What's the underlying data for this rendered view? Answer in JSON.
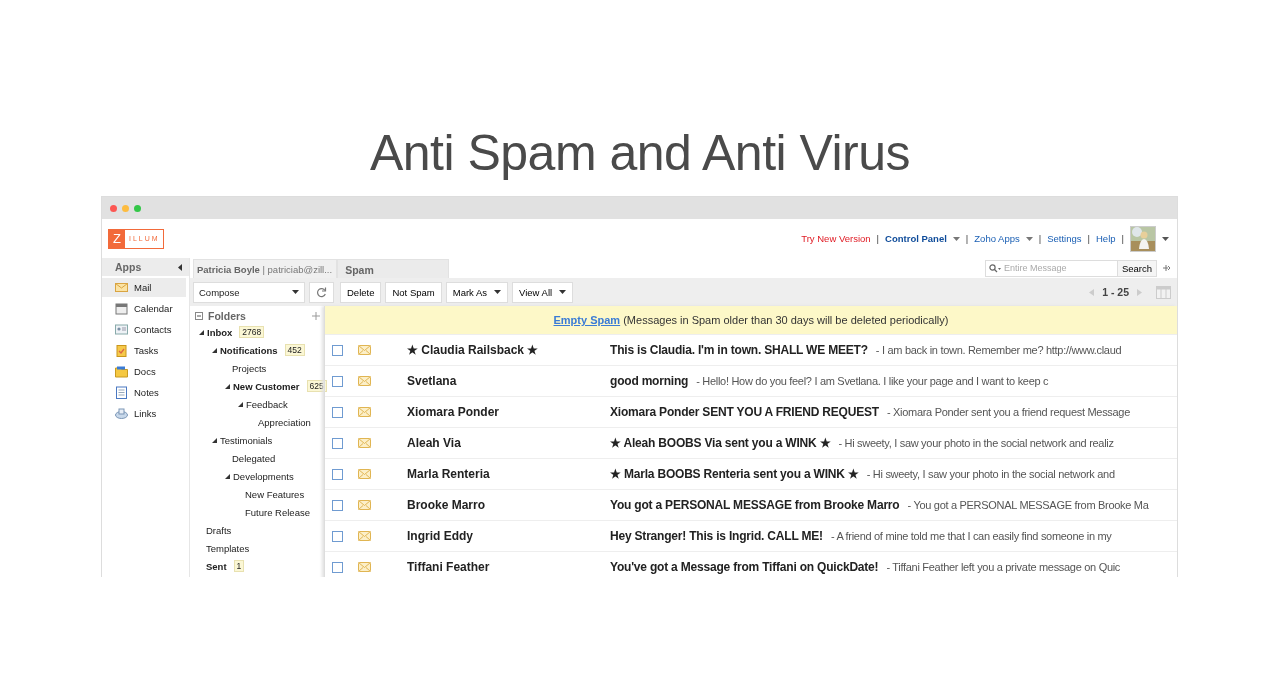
{
  "page_title": "Anti Spam and Anti Virus",
  "app": {
    "logo_letter": "Z",
    "logo_text": "ILLUM",
    "top_links": [
      {
        "label": "Try New Version",
        "kind": "alert",
        "separator": "|"
      },
      {
        "label": "Control Panel",
        "kind": "strong",
        "dropdown": true,
        "separator": "|"
      },
      {
        "label": "Zoho Apps",
        "kind": "link",
        "dropdown": true,
        "separator": "|"
      },
      {
        "label": "Settings",
        "kind": "link",
        "separator": "|"
      },
      {
        "label": "Help",
        "kind": "link",
        "separator": "|"
      }
    ],
    "apps_header": "Apps",
    "apps": [
      {
        "label": "Mail",
        "kind": "mail",
        "selected": true
      },
      {
        "label": "Calendar",
        "kind": "calendar",
        "selected": false
      },
      {
        "label": "Contacts",
        "kind": "contacts",
        "selected": false
      },
      {
        "label": "Tasks",
        "kind": "tasks",
        "selected": false
      },
      {
        "label": "Docs",
        "kind": "docs",
        "selected": false
      },
      {
        "label": "Notes",
        "kind": "notes",
        "selected": false
      },
      {
        "label": "Links",
        "kind": "links",
        "selected": false
      }
    ],
    "account_tab": {
      "name": "Patricia Boyle",
      "email": "| patriciab@zill..."
    },
    "tabs": [
      {
        "label": "Spam",
        "selected": true
      }
    ],
    "search": {
      "placeholder": "Entire Message",
      "button": "Search"
    },
    "compose": "Compose",
    "toolbar": [
      {
        "label": "Delete"
      },
      {
        "label": "Not Spam"
      },
      {
        "label": "Mark As",
        "dropdown": true
      },
      {
        "label": "View All",
        "dropdown": true
      }
    ],
    "pager": "1 - 25",
    "folders": {
      "title": "Folders",
      "items": [
        {
          "name": "Inbox",
          "count": "2768",
          "expanded": true,
          "children": [
            {
              "name": "Notifications",
              "count": "452",
              "expanded": true,
              "children": [
                {
                  "name": "Projects"
                },
                {
                  "name": "New Customer",
                  "count": "625",
                  "expanded": true,
                  "children": [
                    {
                      "name": "Feedback",
                      "expanded": true,
                      "children": [
                        {
                          "name": "Appreciation"
                        }
                      ]
                    }
                  ]
                }
              ]
            },
            {
              "name": "Testimonials",
              "expanded": true,
              "children": [
                {
                  "name": "Delegated"
                },
                {
                  "name": "Developments",
                  "expanded": true,
                  "children": [
                    {
                      "name": "New Features"
                    },
                    {
                      "name": "Future Release"
                    }
                  ]
                }
              ]
            }
          ]
        },
        {
          "name": "Drafts"
        },
        {
          "name": "Templates"
        },
        {
          "name": "Sent",
          "count": "1"
        }
      ]
    },
    "banner": {
      "link": "Empty Spam",
      "text": "(Messages in Spam older than 30 days will be deleted periodically)"
    },
    "messages": [
      {
        "sender": "★ Claudia Railsback ★",
        "subject": "This is Claudia. I'm in town. SHALL WE MEET?",
        "preview": "- I am back in town. Remember me? http://www.claud",
        "checked": false
      },
      {
        "sender": "Svetlana",
        "subject": "good morning",
        "preview": "- Hello! How do you feel? I am Svetlana. I like your page and I want to keep c",
        "checked": false
      },
      {
        "sender": "Xiomara Ponder",
        "subject": "Xiomara Ponder SENT YOU A FRIEND REQUEST",
        "preview": "- Xiomara Ponder sent you a friend request Message",
        "checked": false
      },
      {
        "sender": "Aleah Via",
        "subject": "★ Aleah BOOBS Via sent you a WINK ★",
        "preview": "- Hi sweety, I saw your photo in the social network and realiz",
        "checked": false
      },
      {
        "sender": "Marla Renteria",
        "subject": "★ Marla BOOBS Renteria sent you a WINK ★",
        "preview": "- Hi sweety, I saw your photo in the social network and",
        "checked": false
      },
      {
        "sender": "Brooke Marro",
        "subject": "You got a PERSONAL MESSAGE from Brooke Marro",
        "preview": "- You got a PERSONAL MESSAGE from Brooke Ma",
        "checked": false
      },
      {
        "sender": "Ingrid Eddy",
        "subject": "Hey Stranger! This is Ingrid. CALL ME!",
        "preview": "- A friend of mine told me that I can easily find someone in my",
        "checked": false
      },
      {
        "sender": "Tiffani Feather",
        "subject": "You've got a Message from Tiffani on QuickDate!",
        "preview": "- Tiffani Feather left you a private message on Quic",
        "checked": false
      }
    ]
  }
}
